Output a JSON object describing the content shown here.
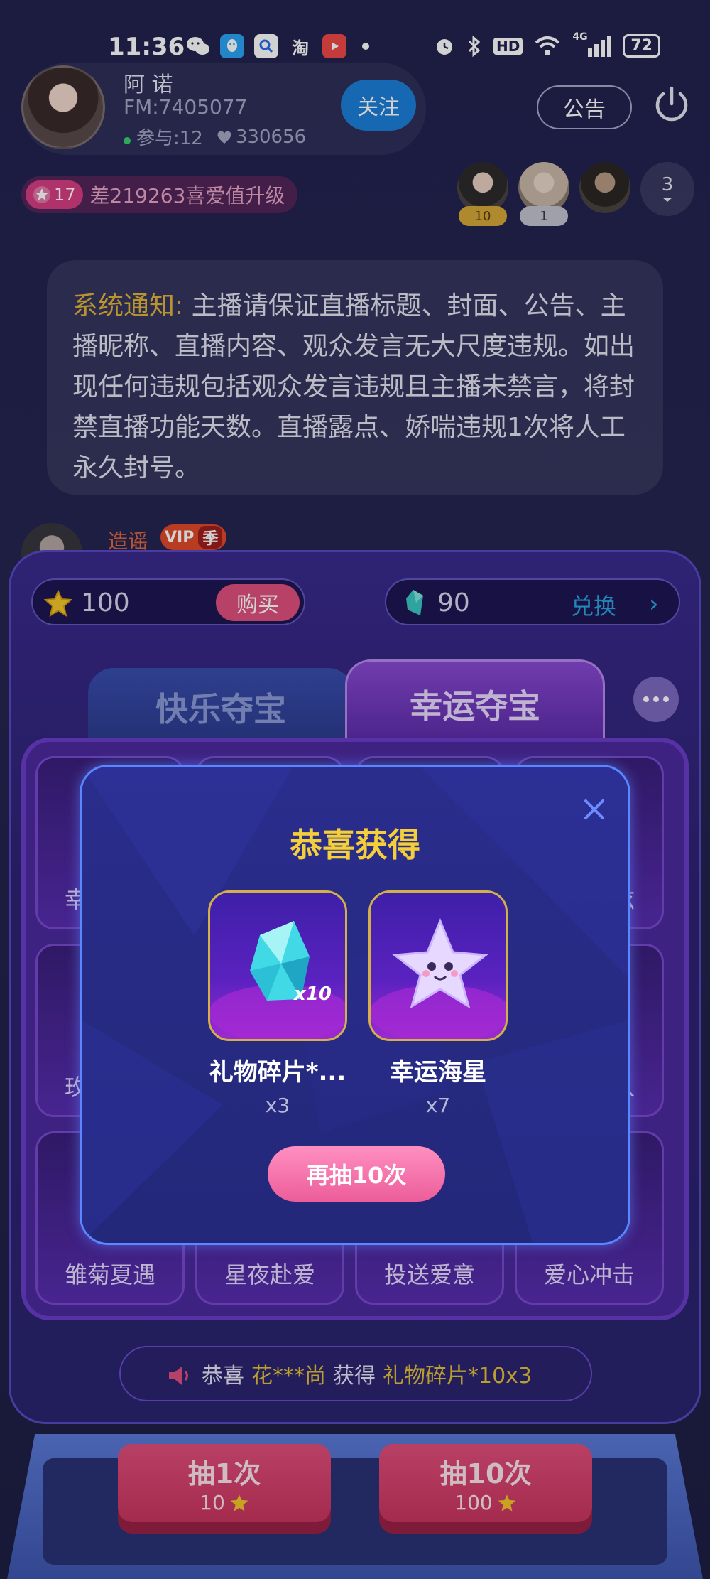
{
  "status_bar": {
    "time": "11:36",
    "apps": [
      "wechat",
      "qq",
      "search",
      "淘",
      "video"
    ],
    "network": "4G",
    "hd": "HD",
    "battery": "72"
  },
  "host": {
    "name": "阿 诺",
    "id": "FM:7405077",
    "participants": "参与:12",
    "likes": "330656",
    "follow_label": "关注"
  },
  "notice_label": "公告",
  "level": {
    "badge": "17",
    "text": "差219263喜爱值升级"
  },
  "viewers": {
    "badges": [
      "10",
      "1"
    ],
    "count": "3"
  },
  "system_message": {
    "label": "系统通知:",
    "text": " 主播请保证直播标题、封面、公告、主播昵称、直播内容、观众发言无大尺度违规。如出现任何违规包括观众发言违规且主播未禁言，将封禁直播功能天数。直播露点、娇喘违规1次将人工永久封号。"
  },
  "chat": {
    "user": "造谣",
    "vip": "VIP",
    "season": "季"
  },
  "currency": {
    "coins": "100",
    "buy_label": "购买",
    "gems": "90",
    "exchange_label": "兑换"
  },
  "tabs": {
    "left": "快乐夺宝",
    "right": "幸运夺宝"
  },
  "grid": {
    "labels": [
      "雏菊夏遇",
      "星夜赴爱",
      "投送爱意",
      "爱心冲击"
    ],
    "peek_chars": [
      "幸",
      "炫",
      "玫",
      "八"
    ]
  },
  "ticker": {
    "prefix": "恭喜",
    "user": "花***尚",
    "verb": "获得",
    "item": "礼物碎片*10x3"
  },
  "draw_buttons": [
    {
      "title": "抽1次",
      "cost": "10"
    },
    {
      "title": "抽10次",
      "cost": "100"
    }
  ],
  "modal": {
    "title": "恭喜获得",
    "rewards": [
      {
        "name": "礼物碎片*...",
        "qty": "x3",
        "tag": "x10"
      },
      {
        "name": "幸运海星",
        "qty": "x7"
      }
    ],
    "again_label": "再抽10次"
  },
  "colors": {
    "accent_pink": "#ec5d9a",
    "title_gold": "#f4cf3a",
    "follow_blue": "#1a7fd8",
    "modal_border": "#5a86ff"
  }
}
